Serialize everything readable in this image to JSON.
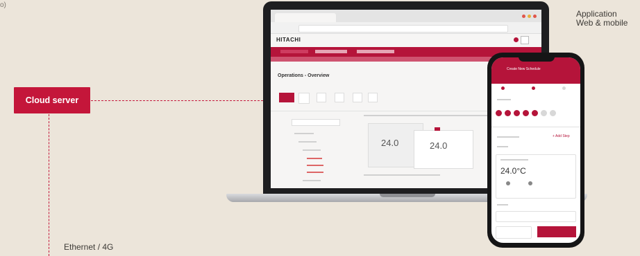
{
  "corner_text": "o)",
  "cloud_label": "Cloud server",
  "ethernet_label": "Ethernet / 4G",
  "application_label": [
    "Application",
    "Web & mobile"
  ],
  "laptop_screen": {
    "logo": "HITACHI",
    "page_title": "Operations - Overview",
    "temperature_1": "24.0",
    "temperature_2": "24.0"
  },
  "phone_screen": {
    "header": "Create New Schedule",
    "add_step": "+ Add Step",
    "temperature": "24.0°C"
  },
  "colors": {
    "accent": "#c4163a",
    "background": "#ece5da"
  }
}
